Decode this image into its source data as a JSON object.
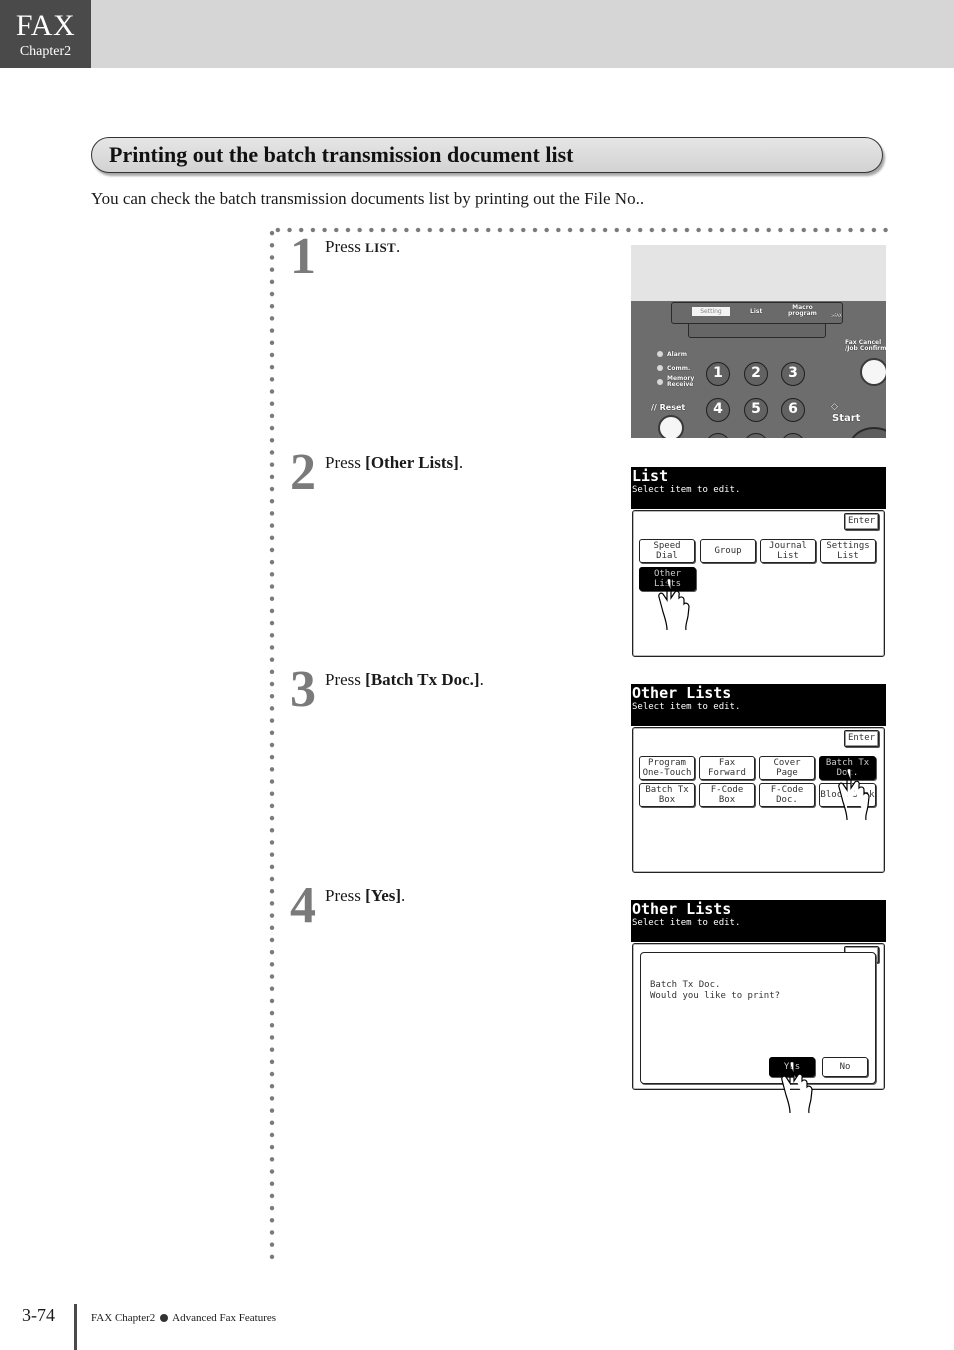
{
  "header": {
    "chapter_title": "FAX",
    "chapter_label": "Chapter2",
    "colors": {
      "tab": "#4a4a4a",
      "band": "#d6d6d6"
    }
  },
  "section": {
    "title": "Printing out the batch transmission document list",
    "intro": "You can check the batch transmission documents list by printing out the File No.."
  },
  "steps": [
    {
      "number": "1",
      "prefix": "Press ",
      "key": "LIST",
      "suffix": "."
    },
    {
      "number": "2",
      "prefix": "Press ",
      "key": "[Other Lists]",
      "suffix": "."
    },
    {
      "number": "3",
      "prefix": "Press ",
      "key": "[Batch Tx Doc.]",
      "suffix": "."
    },
    {
      "number": "4",
      "prefix": "Press ",
      "key": "[Yes]",
      "suffix": "."
    }
  ],
  "control_panel": {
    "tab_setting": "Setting",
    "tab_list": "List",
    "tab_macro": "Macro\nprogram",
    "tab_small": ">FAX",
    "fax_cancel": "Fax Cancel\n/Job Confirm",
    "indicators": [
      "Alarm",
      "Comm.",
      "Memory\nReceive"
    ],
    "reset": "// Reset",
    "start": "Start",
    "keys": [
      "1",
      "2",
      "3",
      "4",
      "5",
      "6"
    ]
  },
  "screens": {
    "list": {
      "title": "List",
      "subtitle": "Select item to edit.",
      "enter": "Enter",
      "buttons": [
        "Speed Dial",
        "Group",
        "Journal\nList",
        "Settings\nList",
        "Other\nLists"
      ],
      "selected": "Other\nLists"
    },
    "other_lists": {
      "title": "Other Lists",
      "subtitle": "Select item to edit.",
      "enter": "Enter",
      "buttons": [
        "Program\nOne-Touch",
        "Fax\nForward",
        "Cover Page",
        "Batch Tx\nDoc.",
        "Batch Tx\nBox",
        "F-Code Box",
        "F-Code\nDoc.",
        "Block Junk"
      ],
      "selected": "Batch Tx\nDoc."
    },
    "confirm": {
      "title": "Other Lists",
      "subtitle": "Select item to edit.",
      "message": "Batch Tx Doc.\nWould you like to print?",
      "yes": "Yes",
      "no": "No"
    }
  },
  "footer": {
    "page_number": "3-74",
    "chapter": "FAX Chapter2",
    "section": "Advanced Fax Features"
  }
}
